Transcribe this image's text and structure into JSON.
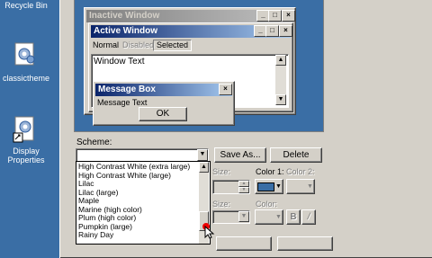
{
  "desktop": {
    "icons": [
      {
        "label": "Recycle Bin"
      },
      {
        "label": "classictheme"
      },
      {
        "label": "Display\nProperties"
      }
    ]
  },
  "preview": {
    "inactive_title": "Inactive Window",
    "active_title": "Active Window",
    "menu": {
      "normal": "Normal",
      "disabled": "Disabled",
      "selected": "Selected"
    },
    "window_text": "Window Text",
    "message_box_title": "Message Box",
    "message_text": "Message Text",
    "ok_label": "OK",
    "caption_buttons": {
      "minimize": "_",
      "maximize": "□",
      "close": "×"
    }
  },
  "scheme": {
    "label": "Scheme:",
    "save_as_label": "Save As...",
    "delete_label": "Delete",
    "options": [
      "High Contrast White (extra large)",
      "High Contrast White (large)",
      "Lilac",
      "Lilac (large)",
      "Maple",
      "Marine (high color)",
      "Plum (high color)",
      "Pumpkin (large)",
      "Rainy Day"
    ]
  },
  "item_controls": {
    "size_label": "Size:",
    "color1_label": "Color 1:",
    "color2_label": "Color 2:",
    "font_size_label": "Size:",
    "font_color_label": "Color:",
    "bold_label": "B",
    "italic_label": "/",
    "color1_value": "#3a6ea5"
  }
}
